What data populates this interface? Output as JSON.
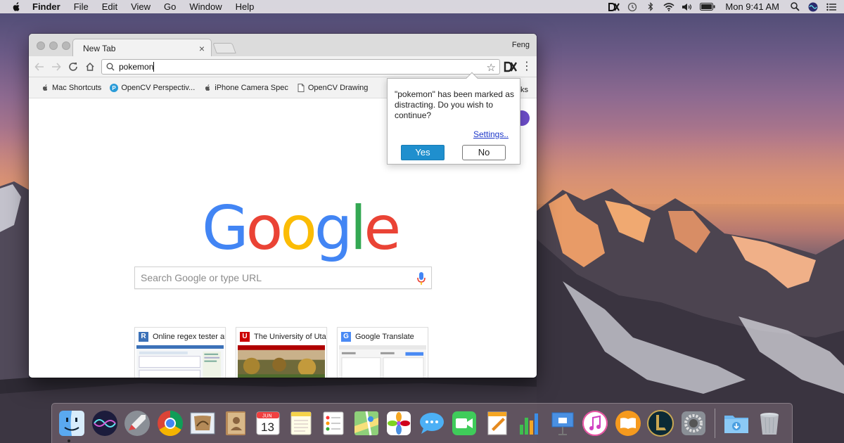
{
  "menubar": {
    "app_name": "Finder",
    "items": [
      "File",
      "Edit",
      "View",
      "Go",
      "Window",
      "Help"
    ],
    "clock": "Mon 9:41 AM"
  },
  "browser": {
    "tab_title": "New Tab",
    "tab_close": "×",
    "profile_name": "Feng",
    "address_value": "pokemon",
    "bookmarks": [
      {
        "label": "Mac Shortcuts",
        "icon": "apple-icon"
      },
      {
        "label": "OpenCV Perspectiv...",
        "icon": "opencv-p-icon"
      },
      {
        "label": "iPhone Camera Spec",
        "icon": "apple-icon"
      },
      {
        "label": "OpenCV Drawing",
        "icon": "page-icon"
      }
    ],
    "bookmarks_overflow": "ks"
  },
  "newtab": {
    "logo_letters": [
      "G",
      "o",
      "o",
      "g",
      "l",
      "e"
    ],
    "logo_colors": [
      "#4285F4",
      "#EA4335",
      "#FBBC05",
      "#4285F4",
      "#34A853",
      "#EA4335"
    ],
    "search_placeholder": "Search Google or type URL",
    "tiles": [
      {
        "title": "Online regex tester an",
        "icon_letter": "R",
        "icon_color": "#3b71b8"
      },
      {
        "title": "The University of Utah",
        "icon_letter": "U",
        "icon_color": "#cc0000"
      },
      {
        "title": "Google Translate",
        "icon_letter": "G",
        "icon_color": "#4a8af4"
      }
    ]
  },
  "popup": {
    "message": "\"pokemon\" has been marked as distracting. Do you wish to continue?",
    "settings_link": "Settings..",
    "yes_label": "Yes",
    "no_label": "No"
  },
  "dock": {
    "apps": [
      "finder-icon",
      "siri-icon",
      "launchpad-icon",
      "chrome-icon",
      "mail-icon",
      "contacts-icon",
      "calendar-icon",
      "notes-icon",
      "reminders-icon",
      "maps-icon",
      "photos-icon",
      "messages-icon",
      "facetime-icon",
      "pages-icon",
      "numbers-icon",
      "keynote-icon",
      "itunes-icon",
      "ibooks-icon",
      "league-of-legends-icon",
      "system-preferences-icon",
      "downloads-icon",
      "trash-icon"
    ],
    "calendar_month": "JUN",
    "calendar_day": "13"
  },
  "colors": {
    "popup_yes": "#1f8fce",
    "settings_link": "#1d37c9",
    "apps_button": "#6a4bc4"
  }
}
